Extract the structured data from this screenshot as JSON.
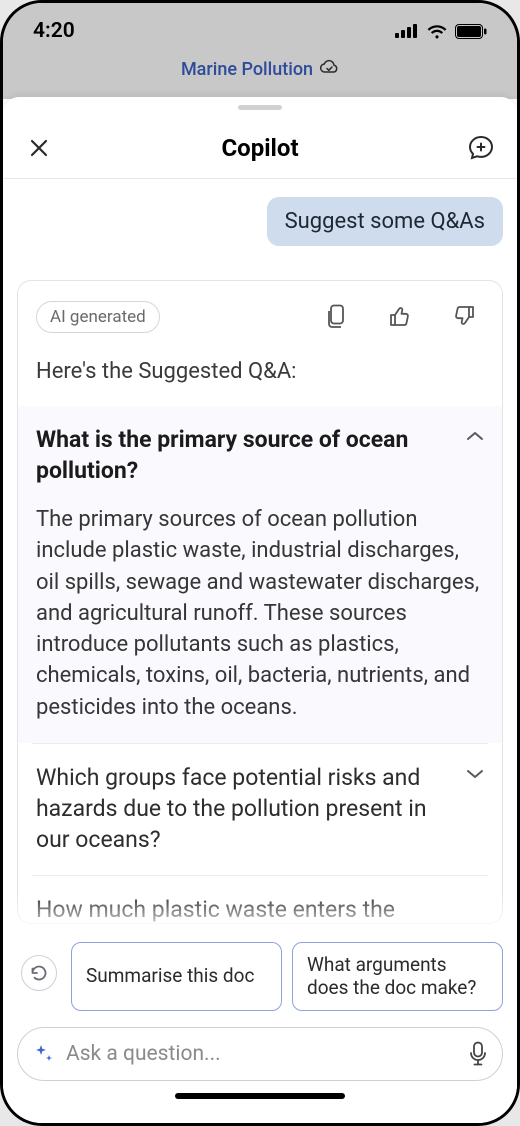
{
  "status": {
    "time": "4:20"
  },
  "doc": {
    "title": "Marine Pollution"
  },
  "panel": {
    "title": "Copilot"
  },
  "chat": {
    "user_message": "Suggest some Q&As",
    "ai": {
      "badge": "AI generated",
      "intro": "Here's the Suggested Q&A:",
      "qa": [
        {
          "question": "What is the primary source of ocean pollution?",
          "answer": "The primary sources of ocean pollution include plastic waste, industrial discharges, oil spills, sewage and wastewater discharges, and agricultural runoff. These sources introduce pollutants such as plastics, chemicals, toxins, oil, bacteria, nutrients, and pesticides into the oceans.",
          "expanded": true
        },
        {
          "question": "Which groups face potential risks and hazards due to the pollution present in our oceans?",
          "expanded": false
        },
        {
          "question": "How much plastic waste enters the",
          "expanded": false
        }
      ]
    }
  },
  "suggestions": {
    "items": [
      "Summarise this doc",
      "What arguments does the doc make?"
    ]
  },
  "input": {
    "placeholder": "Ask a question..."
  }
}
